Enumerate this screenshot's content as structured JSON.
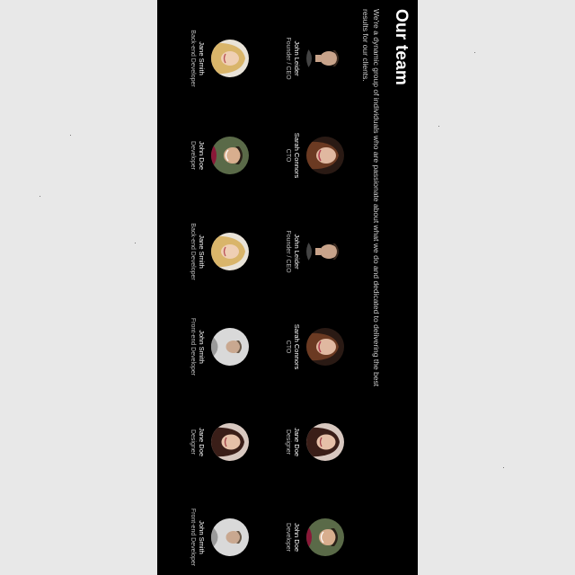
{
  "header": {
    "title": "Our team",
    "description": "We're a dynamic group of individuals who are passionate about what we do and dedicated to delivering the best results for our clients."
  },
  "members": [
    {
      "name": "John Leider",
      "role": "Founder / CEO",
      "avatar": "man-avatar"
    },
    {
      "name": "Sarah Connors",
      "role": "CTO",
      "avatar": "woman-avatar"
    },
    {
      "name": "John Leider",
      "role": "Founder / CEO",
      "avatar": "man-avatar"
    },
    {
      "name": "Sarah Connors",
      "role": "CTO",
      "avatar": "woman-avatar"
    },
    {
      "name": "Jane Doe",
      "role": "Designer",
      "avatar": "woman-avatar"
    },
    {
      "name": "John Doe",
      "role": "Developer",
      "avatar": "man-avatar"
    },
    {
      "name": "Jane Smith",
      "role": "Back-end Developer",
      "avatar": "woman-avatar"
    },
    {
      "name": "John Doe",
      "role": "Developer",
      "avatar": "man-avatar"
    },
    {
      "name": "Jane Smith",
      "role": "Back-end Developer",
      "avatar": "woman-avatar"
    },
    {
      "name": "John Smith",
      "role": "Front-end Developer",
      "avatar": "man-avatar"
    },
    {
      "name": "Jane Doe",
      "role": "Designer",
      "avatar": "woman-avatar"
    },
    {
      "name": "John Smith",
      "role": "Front-end Developer",
      "avatar": "man-avatar"
    }
  ],
  "colors": {
    "panel_background": "#000000",
    "page_background": "#e8e8e8",
    "text_primary": "#ffffff"
  }
}
